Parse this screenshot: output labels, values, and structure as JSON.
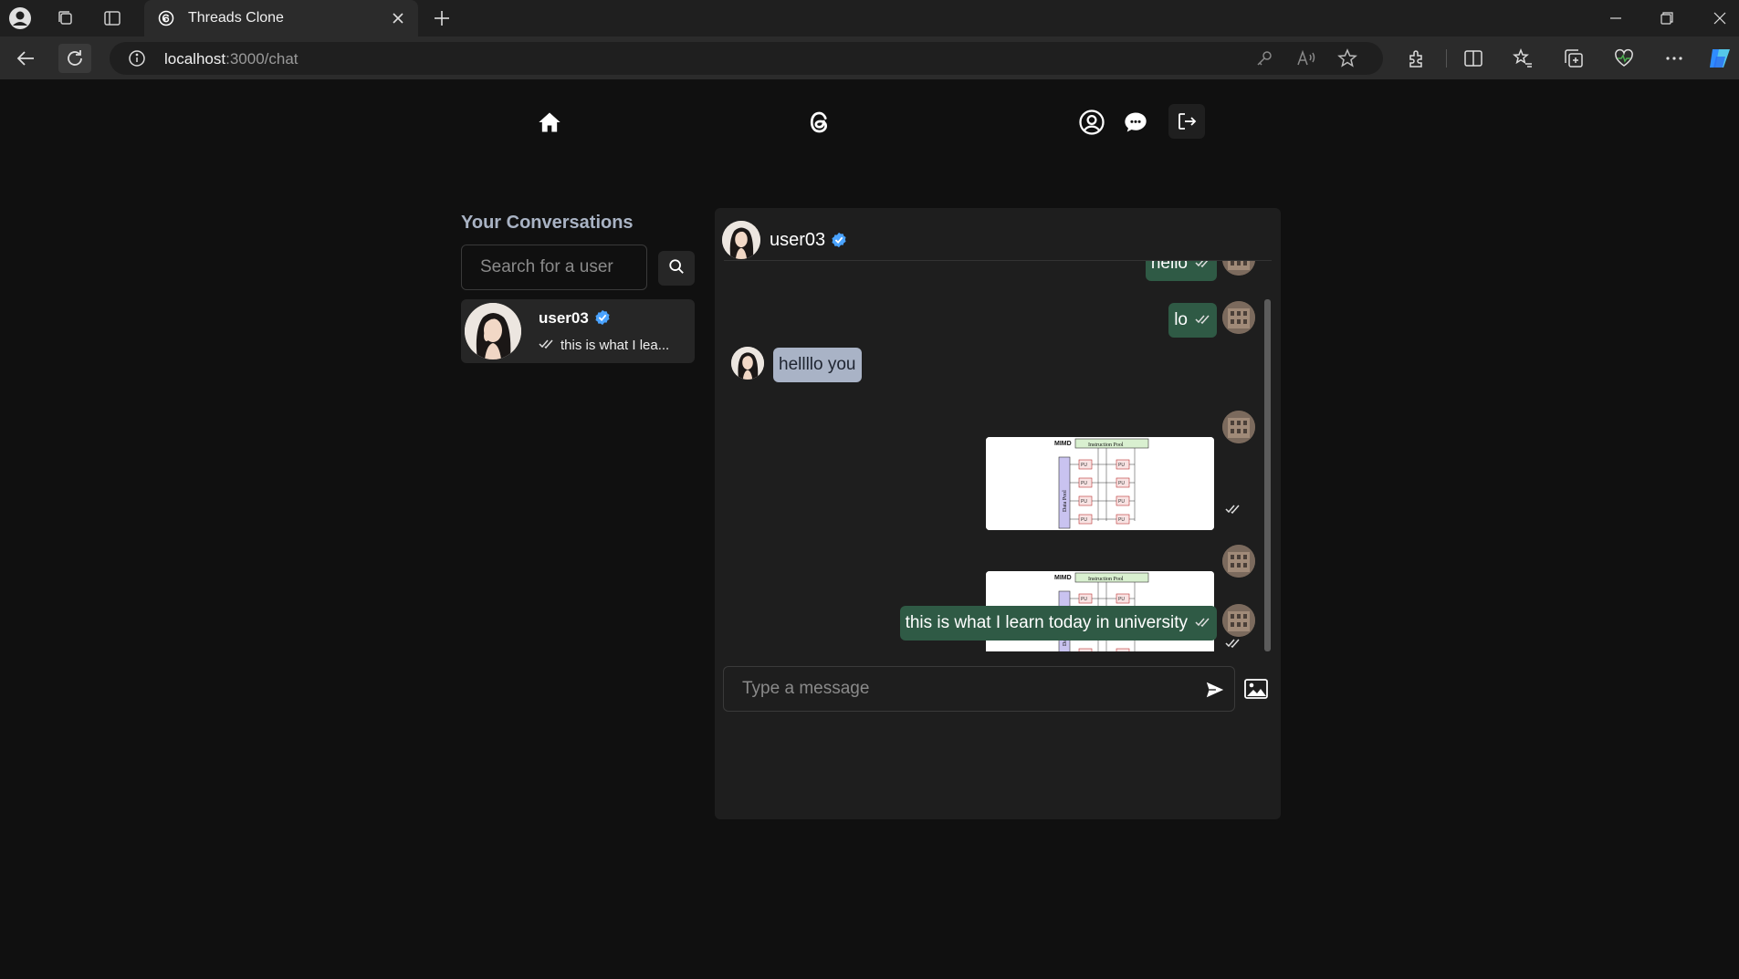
{
  "browser": {
    "tab_title": "Threads Clone",
    "url_host": "localhost",
    "url_path": ":3000/chat"
  },
  "sidebar": {
    "title": "Your Conversations",
    "search_placeholder": "Search for a user",
    "conversations": [
      {
        "username": "user03",
        "verified": true,
        "last_message": "this is what I lea..."
      }
    ]
  },
  "chat": {
    "header_username": "user03",
    "messages": [
      {
        "from": "me",
        "text": "hello"
      },
      {
        "from": "me",
        "text": "lo"
      },
      {
        "from": "them",
        "text": "hellllo you"
      },
      {
        "from": "me",
        "image": "MIMD diagram"
      },
      {
        "from": "me",
        "image": "MIMD diagram"
      },
      {
        "from": "me",
        "text": "this is what I learn today in university"
      }
    ],
    "input_placeholder": "Type a message"
  },
  "diagram": {
    "title": "MIMD",
    "pool_label": "Instruction Pool",
    "data_label": "Data Pool",
    "unit_label": "PU"
  },
  "colors": {
    "bg": "#101010",
    "panel": "#1e1e1e",
    "my_bubble": "#2f5a45",
    "their_bubble": "#a9b3c6",
    "verified": "#4aa3ff"
  }
}
